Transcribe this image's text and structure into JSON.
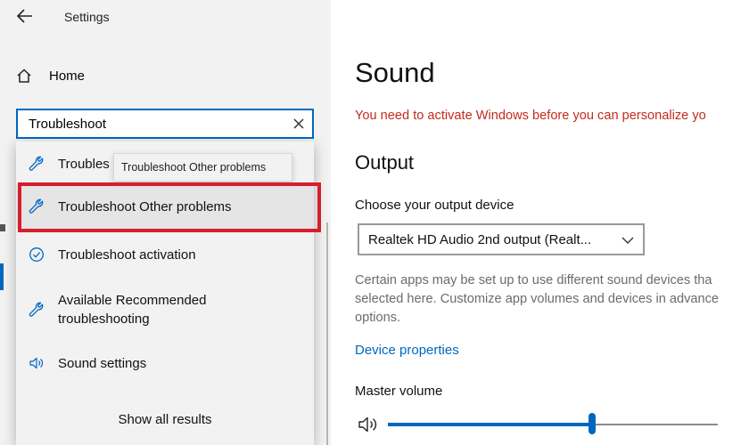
{
  "window": {
    "title": "Settings"
  },
  "nav": {
    "home_label": "Home"
  },
  "search": {
    "value": "Troubleshoot"
  },
  "dropdown": {
    "items": [
      {
        "label": "Troubles",
        "icon": "wrench-icon"
      },
      {
        "label": "Troubleshoot Other problems",
        "icon": "wrench-icon"
      },
      {
        "label": "Troubleshoot activation",
        "icon": "check-circle-icon"
      },
      {
        "label": "Available Recommended\ntroubleshooting",
        "icon": "wrench-icon"
      },
      {
        "label": "Sound settings",
        "icon": "speaker-icon"
      }
    ],
    "show_all": "Show all results",
    "tooltip": "Troubleshoot Other problems",
    "highlight_color": "#d51f2a"
  },
  "sound": {
    "title": "Sound",
    "activation_warning": "You need to activate Windows before you can personalize yo",
    "output_heading": "Output",
    "choose_label": "Choose your output device",
    "device_value": "Realtek HD Audio 2nd output (Realt...",
    "description_lines": [
      "Certain apps may be set up to use different sound devices tha",
      "selected here. Customize app volumes and devices in advance",
      "options."
    ],
    "device_properties_link": "Device properties",
    "master_volume_label": "Master volume",
    "master_volume_fraction": 0.62
  },
  "colors": {
    "accent": "#0067c0",
    "warning": "#c42b1c",
    "pane_bg": "#f2f2f2"
  }
}
